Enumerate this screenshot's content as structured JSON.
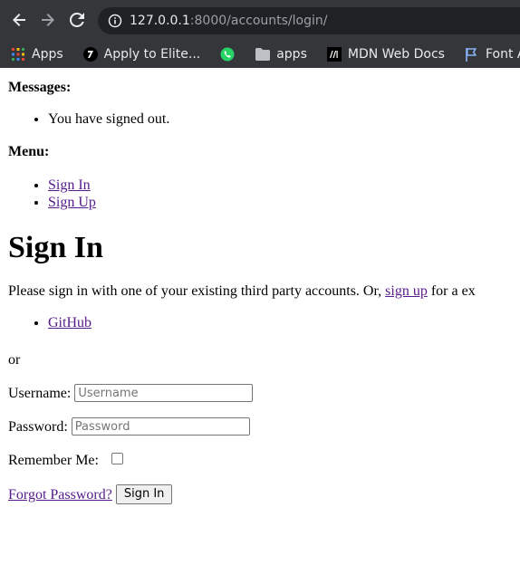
{
  "browser": {
    "url_host": "127.0.0.1",
    "url_rest": ":8000/accounts/login/",
    "bookmarks": [
      {
        "label": "Apps",
        "icon": "apps-grid-icon"
      },
      {
        "label": "Apply to Elite...",
        "icon": "elite-icon"
      },
      {
        "label": "",
        "icon": "whatsapp-icon"
      },
      {
        "label": "apps",
        "icon": "folder-icon"
      },
      {
        "label": "MDN Web Docs",
        "icon": "mdn-icon"
      },
      {
        "label": "Font Awe",
        "icon": "flag-icon"
      }
    ]
  },
  "messages": {
    "title": "Messages:",
    "items": [
      "You have signed out."
    ]
  },
  "menu": {
    "title": "Menu:",
    "items": [
      "Sign In",
      "Sign Up"
    ]
  },
  "signin": {
    "heading": "Sign In",
    "intro_before": "Please sign in with one of your existing third party accounts. Or, ",
    "intro_link": "sign up",
    "intro_after": " for a ex",
    "providers": [
      "GitHub"
    ],
    "or": "or",
    "username_label": "Username:",
    "username_placeholder": "Username",
    "password_label": "Password:",
    "password_placeholder": "Password",
    "remember_label": "Remember Me:",
    "forgot_link": "Forgot Password?",
    "submit_label": "Sign In"
  }
}
